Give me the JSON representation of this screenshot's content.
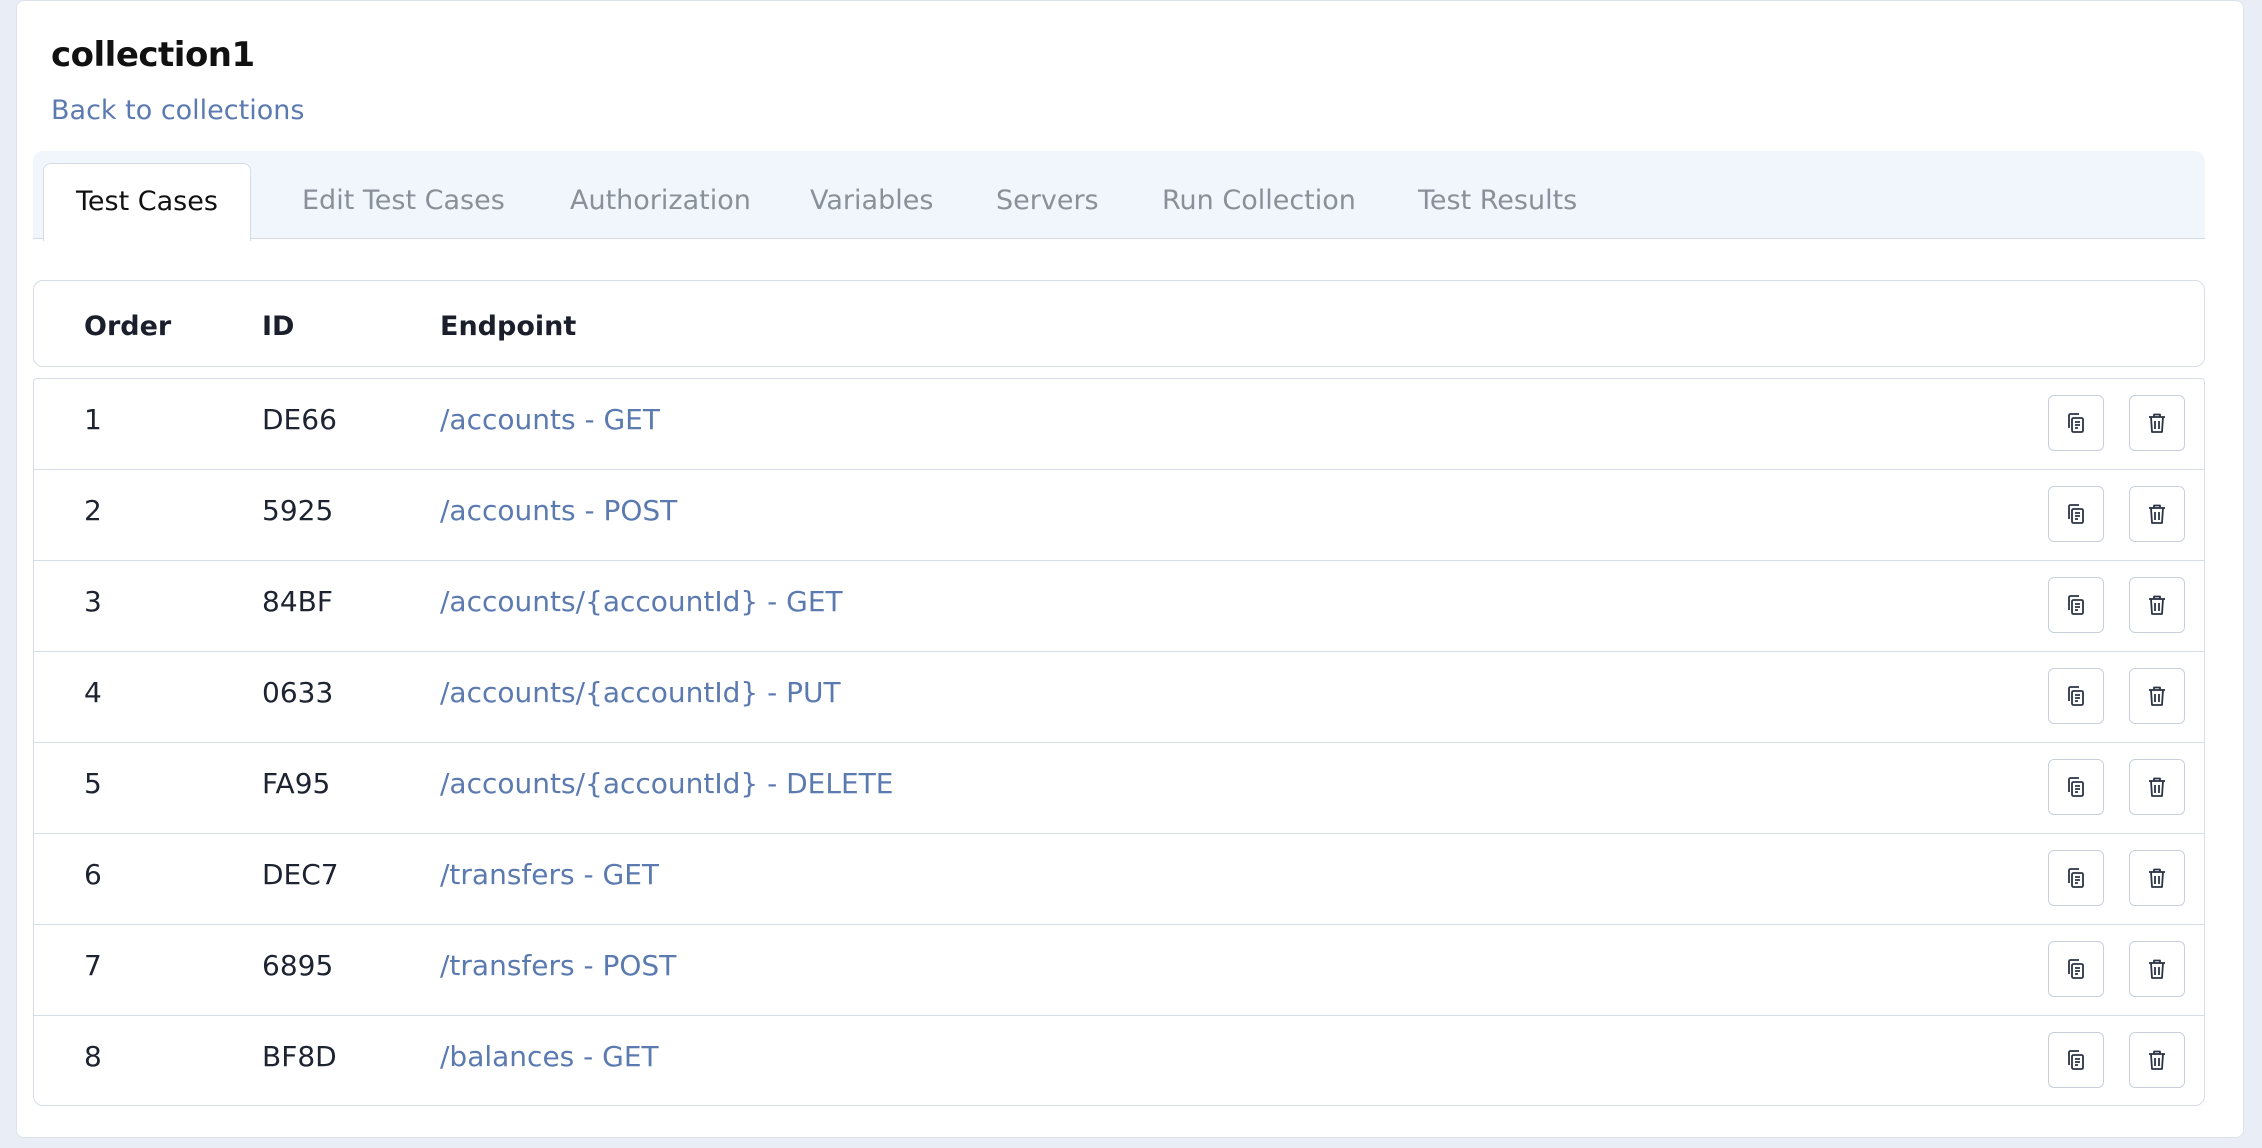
{
  "collection": {
    "title": "collection1",
    "back_link": "Back to collections"
  },
  "tabs": [
    {
      "label": "Test Cases",
      "active": true
    },
    {
      "label": "Edit Test Cases",
      "active": false
    },
    {
      "label": "Authorization",
      "active": false
    },
    {
      "label": "Variables",
      "active": false
    },
    {
      "label": "Servers",
      "active": false
    },
    {
      "label": "Run Collection",
      "active": false
    },
    {
      "label": "Test Results",
      "active": false
    }
  ],
  "table": {
    "headers": {
      "order": "Order",
      "id": "ID",
      "endpoint": "Endpoint"
    },
    "rows": [
      {
        "order": "1",
        "id": "DE66",
        "endpoint": "/accounts - GET"
      },
      {
        "order": "2",
        "id": "5925",
        "endpoint": "/accounts - POST"
      },
      {
        "order": "3",
        "id": "84BF",
        "endpoint": "/accounts/{accountId} - GET"
      },
      {
        "order": "4",
        "id": "0633",
        "endpoint": "/accounts/{accountId} - PUT"
      },
      {
        "order": "5",
        "id": "FA95",
        "endpoint": "/accounts/{accountId} - DELETE"
      },
      {
        "order": "6",
        "id": "DEC7",
        "endpoint": "/transfers - GET"
      },
      {
        "order": "7",
        "id": "6895",
        "endpoint": "/transfers - POST"
      },
      {
        "order": "8",
        "id": "BF8D",
        "endpoint": "/balances - GET"
      }
    ]
  },
  "icons": {
    "copy": "copy-icon",
    "delete": "trash-icon"
  },
  "colors": {
    "link": "#5b7ab0",
    "tabbar_bg": "#f1f6fd",
    "border": "#d7dde6"
  }
}
